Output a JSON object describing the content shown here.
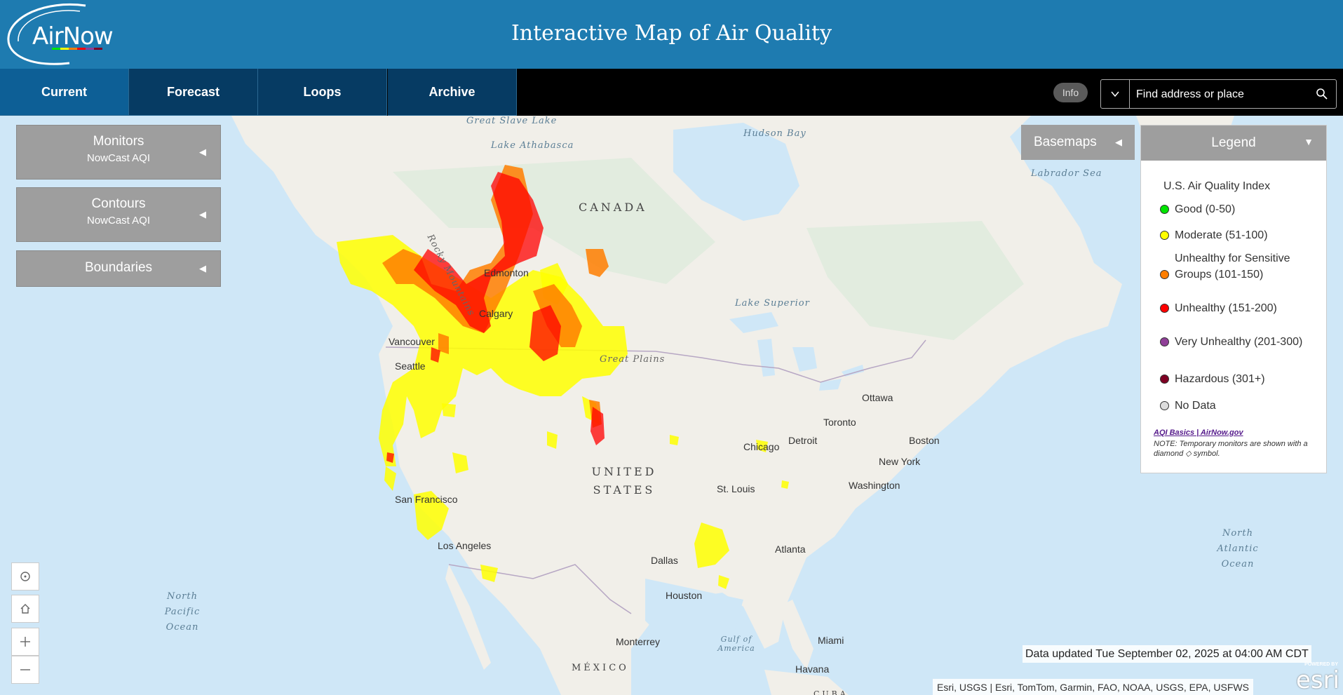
{
  "app": {
    "logo_text": "AirNow",
    "title": "Interactive Map of Air Quality"
  },
  "nav": {
    "tabs": [
      {
        "label": "Current",
        "active": true
      },
      {
        "label": "Forecast",
        "active": false
      },
      {
        "label": "Loops",
        "active": false
      },
      {
        "label": "Archive",
        "active": false
      }
    ],
    "info_label": "Info",
    "search_placeholder": "Find address or place",
    "search_icon": "magnifier-icon",
    "dropdown_icon": "caret-down-icon"
  },
  "panels": {
    "monitors": {
      "title": "Monitors",
      "subtitle": "NowCast AQI"
    },
    "contours": {
      "title": "Contours",
      "subtitle": "NowCast AQI"
    },
    "boundaries": {
      "title": "Boundaries"
    },
    "basemaps": {
      "title": "Basemaps"
    }
  },
  "legend": {
    "title": "Legend",
    "subtitle": "U.S. Air Quality Index",
    "items": [
      {
        "label": "Good (0-50)",
        "color": "#00e400"
      },
      {
        "label": "Moderate (51-100)",
        "color": "#ffff00"
      },
      {
        "label": "Unhealthy for Sensitive Groups (101-150)",
        "color": "#ff7e00"
      },
      {
        "label": "Unhealthy (151-200)",
        "color": "#ff0000"
      },
      {
        "label": "Very Unhealthy (201-300)",
        "color": "#8f3f97"
      },
      {
        "label": "Hazardous (301+)",
        "color": "#7e0023"
      },
      {
        "label": "No Data",
        "color": "#dddddd"
      }
    ],
    "link_text": "AQI Basics | AirNow.gov",
    "note": "NOTE: Temporary monitors are shown with a diamond ◇ symbol."
  },
  "map": {
    "cities": [
      "Edmonton",
      "Calgary",
      "Vancouver",
      "Seattle",
      "San Francisco",
      "Los Angeles",
      "Dallas",
      "Houston",
      "Monterrey",
      "St. Louis",
      "Chicago",
      "Detroit",
      "Toronto",
      "Ottawa",
      "Boston",
      "New York",
      "Washington",
      "Atlanta",
      "Miami",
      "Havana"
    ],
    "places": [
      "Great Slave Lake",
      "Lake Athabasca",
      "Hudson Bay",
      "Labrador Sea",
      "Lake Superior",
      "Great Plains",
      "Rocky Mountains",
      "CANADA",
      "UNITED STATES",
      "MÉXICO",
      "CUBA",
      "North Pacific Ocean",
      "North Atlantic Ocean",
      "Gulf of America"
    ],
    "controls": [
      "locate-icon",
      "home-icon",
      "zoom-in-icon",
      "zoom-out-icon"
    ],
    "updated_text": "Data updated Tue September 02, 2025 at 04:00 AM CDT",
    "attribution": "Esri, USGS | Esri, TomTom, Garmin, FAO, NOAA, USGS, EPA, USFWS",
    "esri_powered": "POWERED BY",
    "esri_name": "esri"
  },
  "colors": {
    "header": "#1e7bb0",
    "tab_bg": "#063b63",
    "tab_active": "#0d5f96",
    "ocean": "#cfe7f7",
    "land": "#f1efe9",
    "aqi_moderate": "#ffff00",
    "aqi_usg": "#ff7e00",
    "aqi_unhealthy": "#ff0000"
  }
}
